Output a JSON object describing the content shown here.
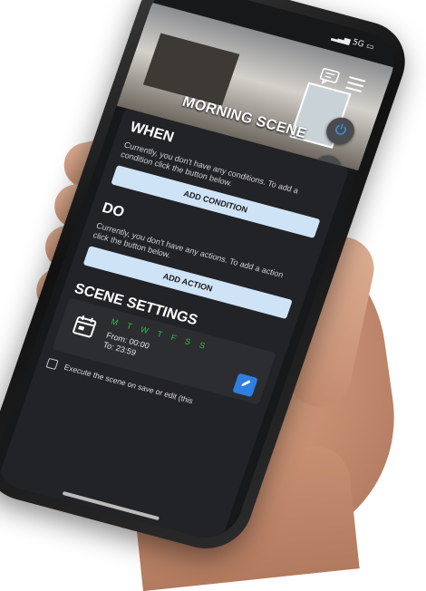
{
  "status": {
    "network": "5G"
  },
  "scene": {
    "title": "MORNING SCENE"
  },
  "when": {
    "heading": "WHEN",
    "description": "Currently, you don't have any conditions. To add a condition click the button below.",
    "button": "ADD CONDITION"
  },
  "do": {
    "heading": "DO",
    "description": "Currently, you don't have any actions. To add a action click the button below.",
    "button": "ADD ACTION"
  },
  "settings": {
    "heading": "SCENE SETTINGS",
    "days": "M T W T F S S",
    "from": "From: 00:00",
    "to": "To: 23:59",
    "execute_label": "Execute the scene on save or edit (this"
  },
  "colors": {
    "accent_green": "#2fbf4a",
    "button_blue": "#cfe3f7",
    "edit_blue": "#2f7fe0",
    "card_bg": "#222326"
  }
}
